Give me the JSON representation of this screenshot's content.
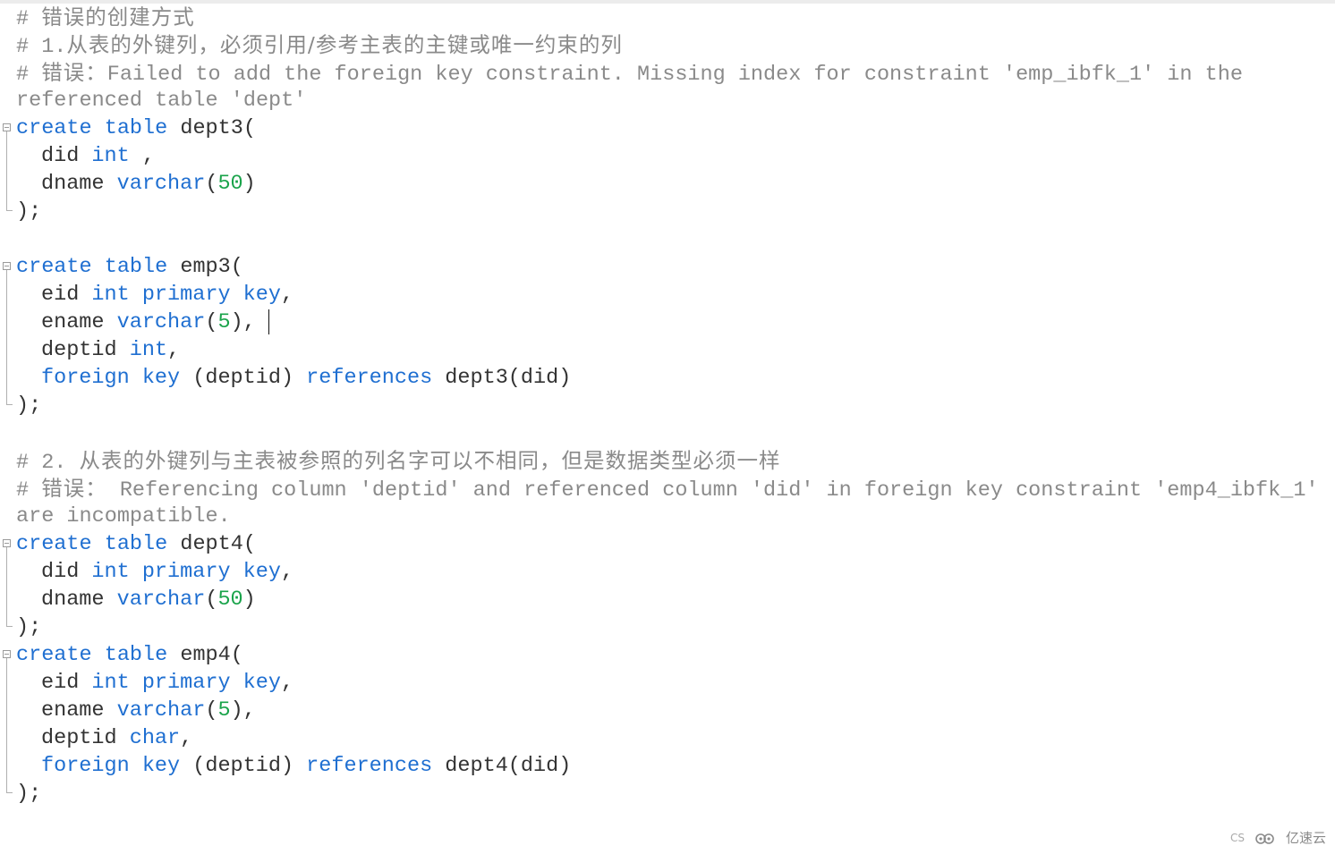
{
  "editor": {
    "lines": [
      {
        "type": "comment",
        "parts": [
          {
            "t": "# ",
            "c": "cmt"
          },
          {
            "t": "错误的创建方式",
            "c": "cmt cjk"
          }
        ]
      },
      {
        "type": "comment",
        "parts": [
          {
            "t": "# 1.",
            "c": "cmt"
          },
          {
            "t": "从表的外键列，必须引用/参考主表的主键或唯一约束的列",
            "c": "cmt cjk"
          }
        ]
      },
      {
        "type": "comment",
        "parts": [
          {
            "t": "# ",
            "c": "cmt"
          },
          {
            "t": "错误：",
            "c": "cmt cjk"
          },
          {
            "t": "Failed to add the foreign key constraint. Missing index for constraint 'emp_ibfk_1' in the",
            "c": "cmt"
          }
        ]
      },
      {
        "type": "comment",
        "parts": [
          {
            "t": "referenced table 'dept'",
            "c": "cmt"
          }
        ]
      },
      {
        "type": "fold-start",
        "parts": [
          {
            "t": "create table ",
            "c": "kw"
          },
          {
            "t": "dept3(",
            "c": "id"
          }
        ]
      },
      {
        "type": "fold-body",
        "parts": [
          {
            "t": "did ",
            "c": "id"
          },
          {
            "t": "int",
            "c": "kw"
          },
          {
            "t": " ,",
            "c": "id"
          }
        ]
      },
      {
        "type": "fold-body",
        "parts": [
          {
            "t": "dname ",
            "c": "id"
          },
          {
            "t": "varchar",
            "c": "kw"
          },
          {
            "t": "(",
            "c": "id"
          },
          {
            "t": "50",
            "c": "num"
          },
          {
            "t": ")",
            "c": "id"
          }
        ]
      },
      {
        "type": "fold-end",
        "parts": [
          {
            "t": ");",
            "c": "id"
          }
        ]
      },
      {
        "type": "blank",
        "parts": []
      },
      {
        "type": "fold-start",
        "parts": [
          {
            "t": "create table ",
            "c": "kw"
          },
          {
            "t": "emp3(",
            "c": "id"
          }
        ]
      },
      {
        "type": "fold-body",
        "parts": [
          {
            "t": "eid ",
            "c": "id"
          },
          {
            "t": "int primary key",
            "c": "kw"
          },
          {
            "t": ",",
            "c": "id"
          }
        ]
      },
      {
        "type": "fold-body",
        "caret": true,
        "parts": [
          {
            "t": "ename ",
            "c": "id"
          },
          {
            "t": "varchar",
            "c": "kw"
          },
          {
            "t": "(",
            "c": "id"
          },
          {
            "t": "5",
            "c": "num"
          },
          {
            "t": "),",
            "c": "id"
          }
        ]
      },
      {
        "type": "fold-body",
        "parts": [
          {
            "t": "deptid ",
            "c": "id"
          },
          {
            "t": "int",
            "c": "kw"
          },
          {
            "t": ",",
            "c": "id"
          }
        ]
      },
      {
        "type": "fold-body",
        "parts": [
          {
            "t": "foreign key ",
            "c": "kw"
          },
          {
            "t": "(deptid) ",
            "c": "id"
          },
          {
            "t": "references ",
            "c": "kw"
          },
          {
            "t": "dept3(did)",
            "c": "id"
          }
        ]
      },
      {
        "type": "fold-end",
        "parts": [
          {
            "t": ");",
            "c": "id"
          }
        ]
      },
      {
        "type": "blank",
        "parts": []
      },
      {
        "type": "comment",
        "parts": [
          {
            "t": "# 2. ",
            "c": "cmt"
          },
          {
            "t": "从表的外键列与主表被参照的列名字可以不相同，但是数据类型必须一样",
            "c": "cmt cjk"
          }
        ]
      },
      {
        "type": "comment",
        "parts": [
          {
            "t": "# ",
            "c": "cmt"
          },
          {
            "t": "错误：",
            "c": "cmt cjk"
          },
          {
            "t": " Referencing column 'deptid' and referenced column 'did' in foreign key constraint 'emp4_ibfk_1'",
            "c": "cmt"
          }
        ]
      },
      {
        "type": "comment",
        "parts": [
          {
            "t": "are incompatible.",
            "c": "cmt"
          }
        ]
      },
      {
        "type": "fold-start",
        "parts": [
          {
            "t": "create table ",
            "c": "kw"
          },
          {
            "t": "dept4(",
            "c": "id"
          }
        ]
      },
      {
        "type": "fold-body",
        "parts": [
          {
            "t": "did ",
            "c": "id"
          },
          {
            "t": "int primary key",
            "c": "kw"
          },
          {
            "t": ",",
            "c": "id"
          }
        ]
      },
      {
        "type": "fold-body",
        "parts": [
          {
            "t": "dname ",
            "c": "id"
          },
          {
            "t": "varchar",
            "c": "kw"
          },
          {
            "t": "(",
            "c": "id"
          },
          {
            "t": "50",
            "c": "num"
          },
          {
            "t": ")",
            "c": "id"
          }
        ]
      },
      {
        "type": "fold-end",
        "parts": [
          {
            "t": ");",
            "c": "id"
          }
        ]
      },
      {
        "type": "fold-start",
        "parts": [
          {
            "t": "create table ",
            "c": "kw"
          },
          {
            "t": "emp4(",
            "c": "id"
          }
        ]
      },
      {
        "type": "fold-body",
        "parts": [
          {
            "t": "eid ",
            "c": "id"
          },
          {
            "t": "int primary key",
            "c": "kw"
          },
          {
            "t": ",",
            "c": "id"
          }
        ]
      },
      {
        "type": "fold-body",
        "parts": [
          {
            "t": "ename ",
            "c": "id"
          },
          {
            "t": "varchar",
            "c": "kw"
          },
          {
            "t": "(",
            "c": "id"
          },
          {
            "t": "5",
            "c": "num"
          },
          {
            "t": "),",
            "c": "id"
          }
        ]
      },
      {
        "type": "fold-body",
        "parts": [
          {
            "t": "deptid ",
            "c": "id"
          },
          {
            "t": "char",
            "c": "kw"
          },
          {
            "t": ",",
            "c": "id"
          }
        ]
      },
      {
        "type": "fold-body",
        "parts": [
          {
            "t": "foreign key ",
            "c": "kw"
          },
          {
            "t": "(deptid) ",
            "c": "id"
          },
          {
            "t": "references ",
            "c": "kw"
          },
          {
            "t": "dept4(did)",
            "c": "id"
          }
        ]
      },
      {
        "type": "fold-end",
        "parts": [
          {
            "t": ");",
            "c": "id"
          }
        ]
      }
    ]
  },
  "watermark": {
    "prefix": "CS",
    "brand": "亿速云",
    "icon": "cloud-icon"
  },
  "colors": {
    "comment": "#8a8a8a",
    "keyword": "#1f6fd1",
    "number": "#19a34a",
    "identifier": "#333333"
  }
}
